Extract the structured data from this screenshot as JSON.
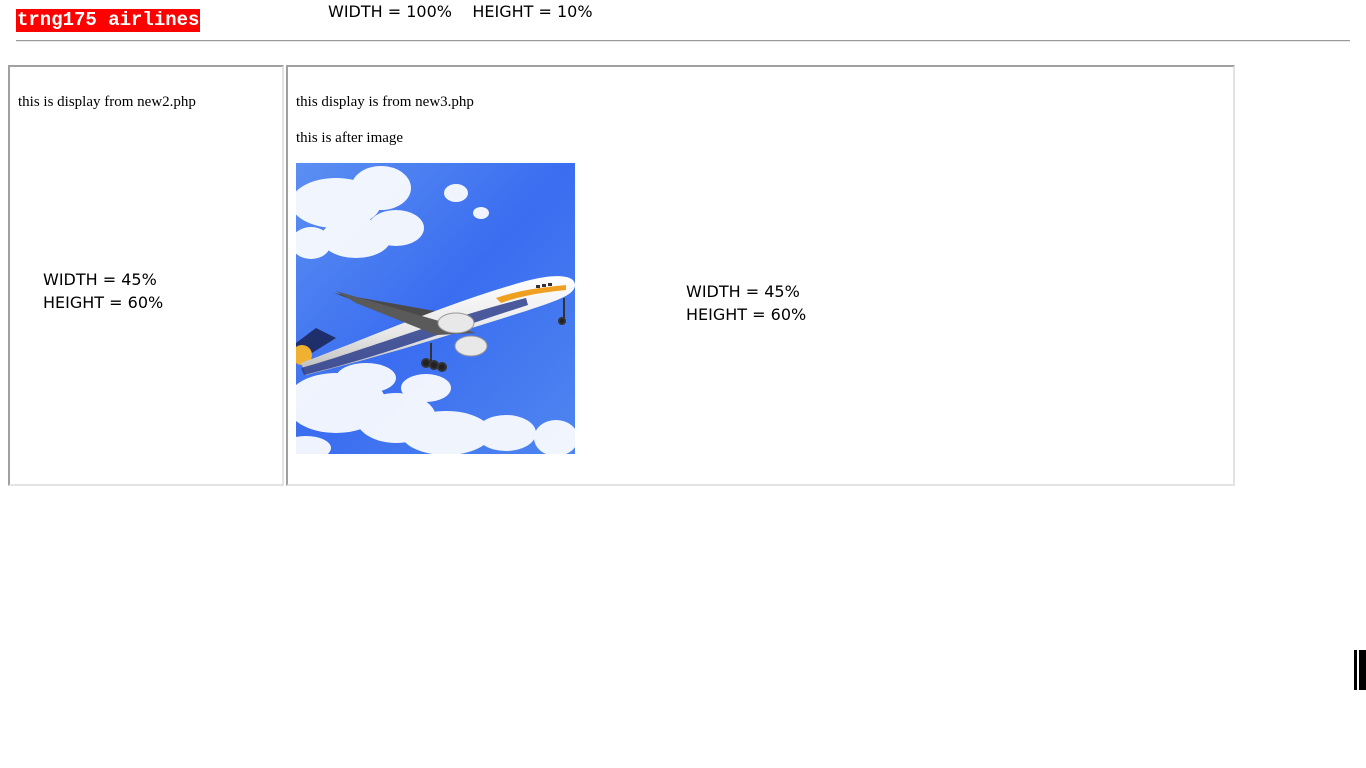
{
  "header": {
    "brand": "trng175 airlines",
    "annotation": "WIDTH = 100%    HEIGHT = 10%"
  },
  "left_frame": {
    "text": "this is display from new2.php",
    "annotation_line1": "WIDTH = 45%",
    "annotation_line2": "HEIGHT = 60%"
  },
  "right_frame": {
    "text1": "this display is from new3.php",
    "text2": "this is after image",
    "image_icon": "airplane-in-sky-image",
    "annotation_line1": "WIDTH = 45%",
    "annotation_line2": "HEIGHT = 60%"
  },
  "colors": {
    "brand_bg": "#ff0000",
    "brand_text": "#ffffff",
    "sky": "#3a6df0"
  }
}
